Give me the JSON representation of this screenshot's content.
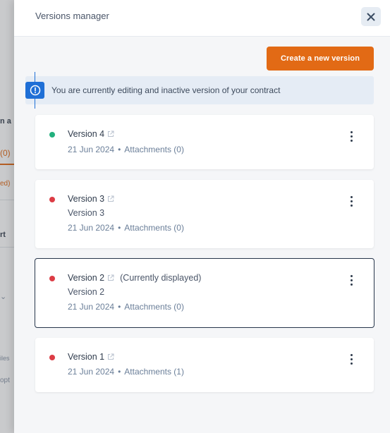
{
  "background": {
    "fragments": [
      "n a",
      "(0)",
      "ed)",
      "rt",
      "(n",
      "iles",
      "opt"
    ]
  },
  "drawer": {
    "title": "Versions manager",
    "close_icon": "close-icon",
    "create_button_label": "Create a new version",
    "alert": {
      "icon": "exclamation-circle-icon",
      "text": "You are currently editing and inactive version of your contract"
    }
  },
  "versions": [
    {
      "name": "Version 4",
      "status": "active",
      "status_color": "#22b07d",
      "description": "",
      "current_label": "",
      "date": "21 Jun 2024",
      "attachments": "Attachments (0)"
    },
    {
      "name": "Version 3",
      "status": "inactive",
      "status_color": "#dc3c45",
      "description": "Version 3",
      "current_label": "",
      "date": "21 Jun 2024",
      "attachments": "Attachments (0)"
    },
    {
      "name": "Version 2",
      "status": "inactive",
      "status_color": "#dc3c45",
      "description": "Version 2",
      "current_label": "(Currently displayed)",
      "date": "21 Jun 2024",
      "attachments": "Attachments (0)"
    },
    {
      "name": "Version 1",
      "status": "inactive",
      "status_color": "#dc3c45",
      "description": "",
      "current_label": "",
      "date": "21 Jun 2024",
      "attachments": "Attachments (1)"
    }
  ],
  "meta_separator": "•",
  "colors": {
    "accent": "#e26a15",
    "info": "#1f6fd6",
    "active_border": "#27364b"
  }
}
